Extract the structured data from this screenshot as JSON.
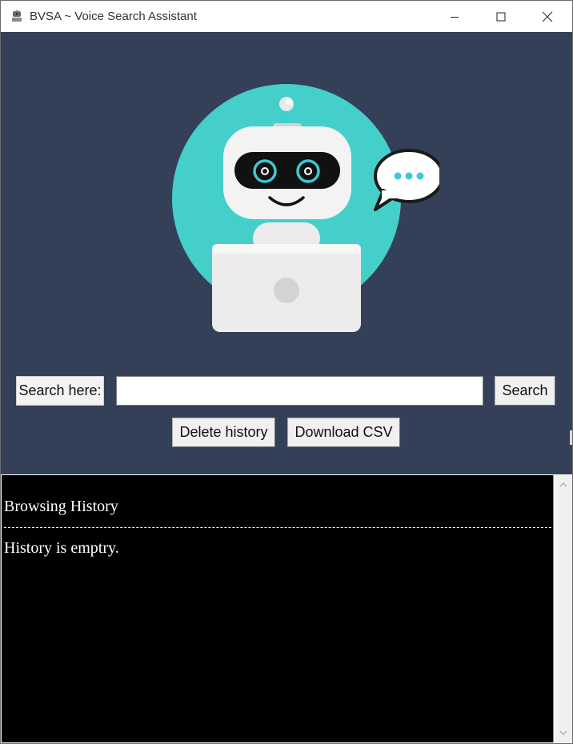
{
  "window": {
    "title": "BVSA ~ Voice Search Assistant",
    "app_icon": "robot-app-icon",
    "controls": [
      "minimize-icon",
      "maximize-icon",
      "close-icon"
    ]
  },
  "hero": {
    "image": "robot-with-laptop-and-speech-bubble",
    "colors": {
      "background": "#344057",
      "circle": "#45CFCB",
      "eyes": "#3EC7D4"
    }
  },
  "search": {
    "label": "Search here:",
    "input_value": "",
    "button_label": "Search"
  },
  "actions": {
    "delete_label": "Delete history",
    "download_label": "Download CSV"
  },
  "history": {
    "title": "Browsing History",
    "empty_message": "History is emptry.",
    "colors": {
      "background": "#000000",
      "text": "#FFFFFF"
    }
  }
}
